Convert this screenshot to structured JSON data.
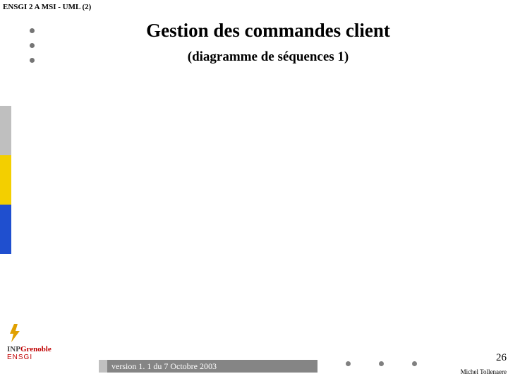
{
  "header_label": "ENSGI 2 A MSI - UML (2)",
  "title": "Gestion des commandes client",
  "subtitle": "(diagramme de séquences 1)",
  "footer_version": "version 1. 1 du 7 Octobre 2003",
  "page_number": "26",
  "author": "Michel Tollenaere",
  "logo": {
    "line1_a": "INP",
    "line1_b": "Grenoble",
    "line2": "ENSGI"
  }
}
